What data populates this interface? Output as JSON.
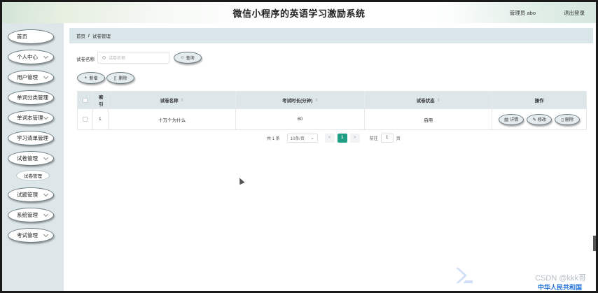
{
  "app": {
    "title": "微信小程序的英语学习激励系统",
    "user_label": "管理员 abo",
    "logout_label": "退出登录"
  },
  "sidebar": {
    "items": [
      {
        "label": "首页",
        "has_arrow": false
      },
      {
        "label": "个人中心",
        "has_arrow": true
      },
      {
        "label": "用户管理",
        "has_arrow": true
      },
      {
        "label": "单词分类管理",
        "has_arrow": false
      },
      {
        "label": "单词本管理",
        "has_arrow": true
      },
      {
        "label": "学习清单管理",
        "has_arrow": false
      },
      {
        "label": "试卷管理",
        "has_arrow": true
      },
      {
        "label": "试题管理",
        "has_arrow": true
      },
      {
        "label": "系统管理",
        "has_arrow": true
      },
      {
        "label": "考试管理",
        "has_arrow": true
      }
    ],
    "submenu": {
      "label": "试卷管理"
    }
  },
  "breadcrumb": {
    "home": "首页",
    "separator": "/",
    "current": "试卷管理"
  },
  "search": {
    "label": "试卷名称",
    "placeholder": "试卷名称",
    "button_label": "查询"
  },
  "toolbar": {
    "add_label": "新增",
    "delete_label": "删除"
  },
  "table": {
    "headers": {
      "index": "索引",
      "name": "试卷名称",
      "duration": "考试时长(分钟)",
      "status": "试卷状态",
      "actions": "操作"
    },
    "sort_icon": "⇕",
    "rows": [
      {
        "index": "1",
        "name": "十万个为什么",
        "duration": "60",
        "status": "启用"
      }
    ],
    "row_actions": {
      "detail": "详情",
      "edit": "修改",
      "delete": "删除"
    }
  },
  "pagination": {
    "total_label": "共 1 条",
    "page_size": "10条/页",
    "prev": "<",
    "current_page": "1",
    "next": ">",
    "goto_label": "前往",
    "goto_value": "1",
    "page_unit": "页"
  },
  "watermark": {
    "text": "CSDN @kkk哥",
    "sub_text": "中华人民共和国"
  }
}
